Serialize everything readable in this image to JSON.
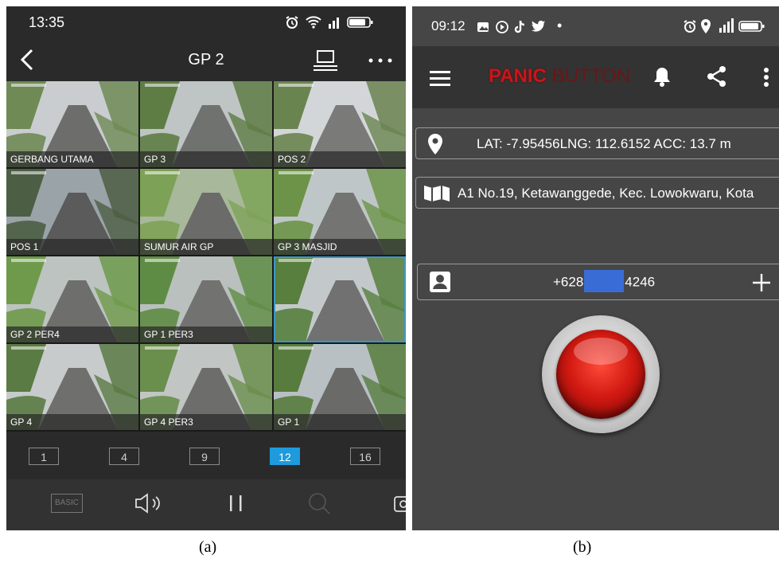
{
  "figure": {
    "caption_a": "(a)",
    "caption_b": "(b)"
  },
  "phone_a": {
    "status": {
      "time": "13:35",
      "icons": [
        "alarm-icon",
        "wifi-icon",
        "signal-icon",
        "battery-icon"
      ]
    },
    "header": {
      "title": "GP 2",
      "back_icon": "back-arrow-icon",
      "monitor_icon": "monitor-icon",
      "more_icon": "more-dots-icon"
    },
    "cameras": [
      {
        "label": "GERBANG UTAMA",
        "sky": "#c9cdd0",
        "ground": "#6d6e6b",
        "green": "#6f8a55"
      },
      {
        "label": "GP 3",
        "sky": "#bfc4c4",
        "ground": "#707270",
        "green": "#5e7d45"
      },
      {
        "label": "POS 2",
        "sky": "#d3d6d8",
        "ground": "#7a7b79",
        "green": "#6a8450"
      },
      {
        "label": "POS 1",
        "sky": "#9aa3a8",
        "ground": "#5a5b5a",
        "green": "#4c5e44"
      },
      {
        "label": "SUMUR AIR GP",
        "sky": "#a8b89a",
        "ground": "#6b6c69",
        "green": "#7da257"
      },
      {
        "label": "GP 3 MASJID",
        "sky": "#bfc6c8",
        "ground": "#747572",
        "green": "#6c9348"
      },
      {
        "label": "GP 2 PER4",
        "sky": "#bcc3c0",
        "ground": "#6e6f6c",
        "green": "#6f9a4b"
      },
      {
        "label": "GP 1 PER3",
        "sky": "#b9c0bd",
        "ground": "#727370",
        "green": "#5f8c45"
      },
      {
        "label": "",
        "sky": "#c3c9cb",
        "ground": "#707170",
        "green": "#587f3e",
        "selected": true
      },
      {
        "label": "GP 4",
        "sky": "#c7cbcc",
        "ground": "#6f706e",
        "green": "#5a7b44"
      },
      {
        "label": "GP 4 PER3",
        "sky": "#c1c6c5",
        "ground": "#6d6e6b",
        "green": "#6a8e4c"
      },
      {
        "label": "GP 1",
        "sky": "#b8c0c4",
        "ground": "#6a6b69",
        "green": "#587c3e"
      }
    ],
    "layouts": [
      "1",
      "4",
      "9",
      "12",
      "16"
    ],
    "active_layout": "12",
    "toolbar": {
      "basic_label": "BASIC",
      "icons": [
        "speaker-icon",
        "pause-icon",
        "search-icon",
        "camera-icon"
      ]
    },
    "colors": {
      "accent": "#1d9bdc",
      "selected_border": "#3a97c9"
    }
  },
  "phone_b": {
    "status": {
      "time": "09:12",
      "dot": "•",
      "icons": [
        "gallery-icon",
        "record-icon",
        "tiktok-icon",
        "twitter-icon",
        "alarm-icon",
        "location-icon",
        "signal-icon",
        "battery-icon"
      ]
    },
    "appbar": {
      "brand_part1": "PANIC",
      "brand_part2": "BUTTON",
      "icons": [
        "menu-icon",
        "bell-icon",
        "share-icon",
        "overflow-icon"
      ]
    },
    "coords": {
      "text": "LAT: -7.95456LNG: 112.6152  ACC: 13.7 m",
      "icon": "location-pin-icon"
    },
    "address": {
      "text": "A1 No.19, Ketawanggede, Kec. Lowokwaru, Kota",
      "icon": "map-icon"
    },
    "contact": {
      "phone_prefix": "+628",
      "phone_suffix": "4246",
      "icon": "contact-icon",
      "add_icon": "add-icon"
    },
    "panic_button": {
      "icon": "panic-button-icon"
    },
    "colors": {
      "brand_red": "#c6171a",
      "button_red": "#d21a12",
      "redaction": "#3a6cd6"
    }
  }
}
